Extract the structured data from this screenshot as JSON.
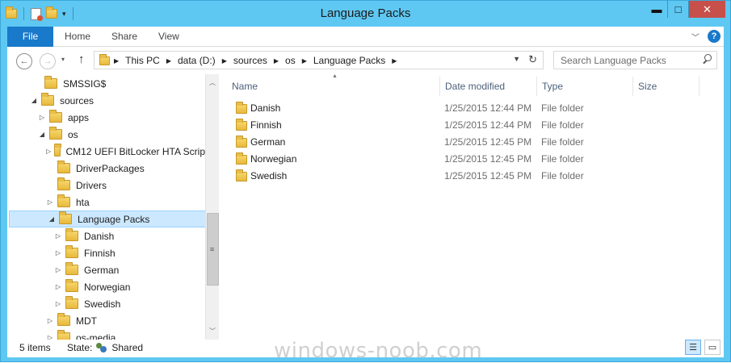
{
  "window": {
    "title": "Language Packs",
    "controls": {
      "minimize": "▬",
      "maximize": "□",
      "close": "✕"
    }
  },
  "ribbon": {
    "tabs": [
      "File",
      "Home",
      "Share",
      "View"
    ],
    "help": "?"
  },
  "nav": {
    "breadcrumbs": [
      "This PC",
      "data (D:)",
      "sources",
      "os",
      "Language Packs"
    ],
    "search_placeholder": "Search Language Packs"
  },
  "tree": [
    {
      "label": "SMSSIG$",
      "indent": 0,
      "arrow": ""
    },
    {
      "label": "sources",
      "indent": 0,
      "arrow": "◢"
    },
    {
      "label": "apps",
      "indent": 1,
      "arrow": "▷"
    },
    {
      "label": "os",
      "indent": 1,
      "arrow": "◢"
    },
    {
      "label": "CM12 UEFI BitLocker HTA Scrip",
      "indent": 2,
      "arrow": "▷"
    },
    {
      "label": "DriverPackages",
      "indent": 2,
      "arrow": ""
    },
    {
      "label": "Drivers",
      "indent": 2,
      "arrow": ""
    },
    {
      "label": "hta",
      "indent": 2,
      "arrow": "▷"
    },
    {
      "label": "Language Packs",
      "indent": 2,
      "arrow": "◢",
      "selected": true
    },
    {
      "label": "Danish",
      "indent": 3,
      "arrow": "▷"
    },
    {
      "label": "Finnish",
      "indent": 3,
      "arrow": "▷"
    },
    {
      "label": "German",
      "indent": 3,
      "arrow": "▷"
    },
    {
      "label": "Norwegian",
      "indent": 3,
      "arrow": "▷"
    },
    {
      "label": "Swedish",
      "indent": 3,
      "arrow": "▷"
    },
    {
      "label": "MDT",
      "indent": 2,
      "arrow": "▷"
    },
    {
      "label": "os-media",
      "indent": 2,
      "arrow": "▷"
    }
  ],
  "columns": {
    "name": "Name",
    "date": "Date modified",
    "type": "Type",
    "size": "Size"
  },
  "files": [
    {
      "name": "Danish",
      "date": "1/25/2015 12:44 PM",
      "type": "File folder"
    },
    {
      "name": "Finnish",
      "date": "1/25/2015 12:44 PM",
      "type": "File folder"
    },
    {
      "name": "German",
      "date": "1/25/2015 12:45 PM",
      "type": "File folder"
    },
    {
      "name": "Norwegian",
      "date": "1/25/2015 12:45 PM",
      "type": "File folder"
    },
    {
      "name": "Swedish",
      "date": "1/25/2015 12:45 PM",
      "type": "File folder"
    }
  ],
  "status": {
    "items": "5 items",
    "state_label": "State:",
    "state_value": "Shared"
  },
  "watermark": "windows-noob.com",
  "colors": {
    "titlebar": "#5ec8f2",
    "file_tab": "#1979ca",
    "close_button": "#c7504a",
    "selection": "#cce8ff"
  }
}
